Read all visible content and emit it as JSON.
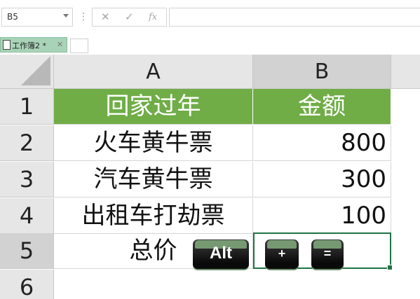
{
  "formula_bar": {
    "name_box": "B5",
    "menu_dots": "⋮",
    "cancel_symbol": "✕",
    "enter_symbol": "✓",
    "function_symbol": "fx",
    "formula_value": ""
  },
  "workbook_tab": {
    "label": "工作簿2 *",
    "close_symbol": "✕"
  },
  "columns": [
    "A",
    "B"
  ],
  "rows": [
    "1",
    "2",
    "3",
    "4",
    "5",
    "6"
  ],
  "cells": {
    "A1": "回家过年",
    "B1": "金额",
    "A2": "火车黄牛票",
    "B2": "800",
    "A3": "汽车黄牛票",
    "B3": "300",
    "A4": "出租车打劫票",
    "B4": "100",
    "A5": "总价",
    "B5": ""
  },
  "header_fill_color": "#70ad47",
  "selected_cell": "B5",
  "keys": {
    "alt": "Alt",
    "plus": "+",
    "equals": "="
  }
}
